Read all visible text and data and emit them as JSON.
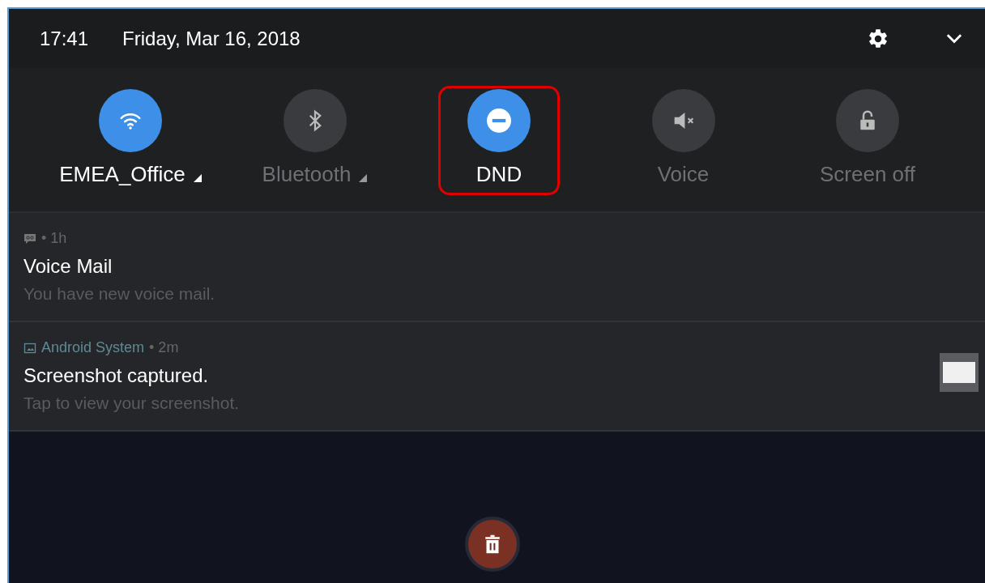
{
  "status_bar": {
    "time": "17:41",
    "date": "Friday, Mar 16, 2018"
  },
  "tiles": [
    {
      "kind": "wifi",
      "label": "EMEA_Office",
      "on": true,
      "has_menu": true,
      "highlighted": false
    },
    {
      "kind": "bluetooth",
      "label": "Bluetooth",
      "on": false,
      "has_menu": true,
      "highlighted": false
    },
    {
      "kind": "dnd",
      "label": "DND",
      "on": true,
      "has_menu": false,
      "highlighted": true
    },
    {
      "kind": "sound",
      "label": "Voice",
      "on": false,
      "has_menu": false,
      "highlighted": false
    },
    {
      "kind": "lock",
      "label": "Screen off",
      "on": false,
      "has_menu": false,
      "highlighted": false
    }
  ],
  "notifications": [
    {
      "kind": "voicemail",
      "time": "• 1h",
      "title": "Voice Mail",
      "text": "You have new voice mail.",
      "thumbnail": false
    },
    {
      "kind": "image",
      "app": "Android System",
      "time": "• 2m",
      "title": "Screenshot captured.",
      "text": "Tap to view your screenshot.",
      "thumbnail": true
    }
  ]
}
